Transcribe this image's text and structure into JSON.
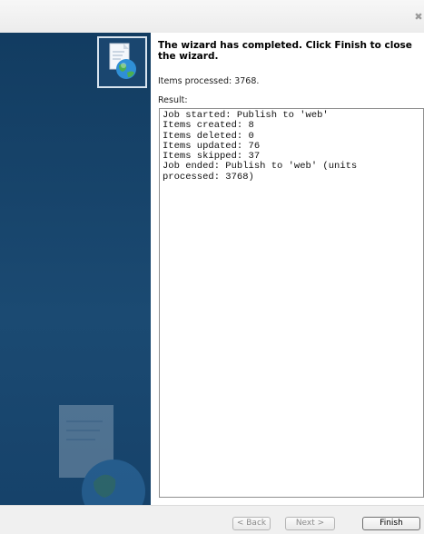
{
  "window": {
    "close_glyph": "✖"
  },
  "sidebar": {
    "logo_icon": "web-document-globe-icon",
    "background_art": "document-globe-watermark"
  },
  "content": {
    "headline": "The wizard has completed. Click Finish to close the wizard.",
    "items_processed": "Items processed: 3768.",
    "result_label": "Result:",
    "result_lines": [
      "Job started: Publish to 'web'",
      "Items created: 8",
      "Items deleted: 0",
      "Items updated: 76",
      "Items skipped: 37",
      "Job ended: Publish to 'web' (units",
      "processed: 3768)"
    ]
  },
  "footer": {
    "back_label": "< Back",
    "next_label": "Next >",
    "finish_label": "Finish"
  },
  "colors": {
    "sidebar": "#123c61",
    "content_bg": "#ffffff",
    "footer_bg": "#f0f0f0"
  }
}
